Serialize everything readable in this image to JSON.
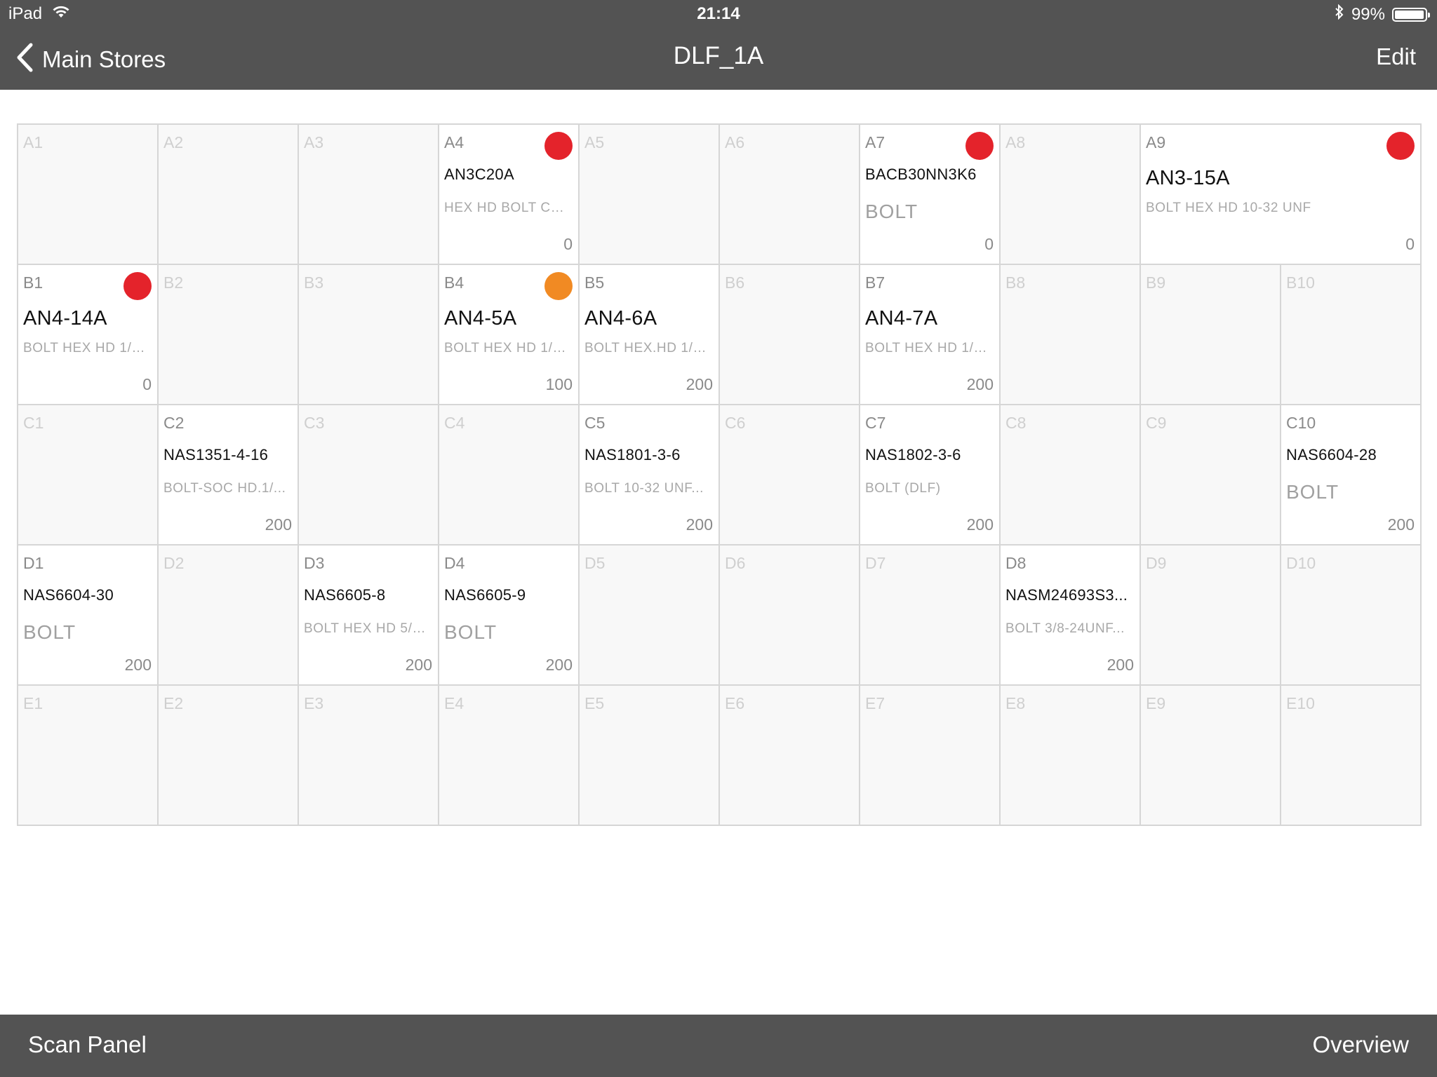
{
  "status_bar": {
    "device": "iPad",
    "time": "21:14",
    "battery": "99%",
    "wifi_icon": "wifi-icon",
    "bluetooth_icon": "bluetooth-icon",
    "battery_icon": "battery-icon",
    "battery_level": 0.99
  },
  "navbar": {
    "back_label": "Main Stores",
    "title": "DLF_1A",
    "edit_label": "Edit"
  },
  "colors": {
    "bar": "#535353",
    "alert_red": "#e4232b",
    "alert_orange": "#f18a23"
  },
  "grid": {
    "rows": [
      {
        "cells": [
          {
            "loc": "A1"
          },
          {
            "loc": "A2"
          },
          {
            "loc": "A3"
          },
          {
            "loc": "A4",
            "part": "AN3C20A",
            "desc": "HEX HD BOLT CR...",
            "qty": "0",
            "dot": "red"
          },
          {
            "loc": "A5"
          },
          {
            "loc": "A6"
          },
          {
            "loc": "A7",
            "part": "BACB30NN3K6",
            "desc": "BOLT",
            "desc_big": true,
            "qty": "0",
            "dot": "red"
          },
          {
            "loc": "A8"
          },
          {
            "loc": "A9",
            "part": "AN3-15A",
            "part_big": true,
            "desc": "BOLT HEX HD 10-32 UNF",
            "qty": "0",
            "dot": "red",
            "wide": true
          }
        ]
      },
      {
        "cells": [
          {
            "loc": "B1",
            "part": "AN4-14A",
            "part_big": true,
            "desc": "BOLT HEX HD 1/4...",
            "qty": "0",
            "dot": "red"
          },
          {
            "loc": "B2"
          },
          {
            "loc": "B3"
          },
          {
            "loc": "B4",
            "part": "AN4-5A",
            "part_big": true,
            "desc": "BOLT HEX HD 1/4...",
            "qty": "100",
            "dot": "orange"
          },
          {
            "loc": "B5",
            "part": "AN4-6A",
            "part_big": true,
            "desc": "BOLT HEX.HD 1/4...",
            "qty": "200"
          },
          {
            "loc": "B6"
          },
          {
            "loc": "B7",
            "part": "AN4-7A",
            "part_big": true,
            "desc": "BOLT HEX HD 1/4...",
            "qty": "200"
          },
          {
            "loc": "B8"
          },
          {
            "loc": "B9"
          },
          {
            "loc": "B10"
          }
        ]
      },
      {
        "cells": [
          {
            "loc": "C1"
          },
          {
            "loc": "C2",
            "part": "NAS1351-4-16",
            "desc": "BOLT-SOC HD.1/...",
            "qty": "200"
          },
          {
            "loc": "C3"
          },
          {
            "loc": "C4"
          },
          {
            "loc": "C5",
            "part": "NAS1801-3-6",
            "desc": "BOLT 10-32 UNF...",
            "qty": "200"
          },
          {
            "loc": "C6"
          },
          {
            "loc": "C7",
            "part": "NAS1802-3-6",
            "desc": "BOLT (DLF)",
            "qty": "200"
          },
          {
            "loc": "C8"
          },
          {
            "loc": "C9"
          },
          {
            "loc": "C10",
            "part": "NAS6604-28",
            "desc": "BOLT",
            "desc_big": true,
            "qty": "200"
          }
        ]
      },
      {
        "cells": [
          {
            "loc": "D1",
            "part": "NAS6604-30",
            "desc": "BOLT",
            "desc_big": true,
            "qty": "200"
          },
          {
            "loc": "D2"
          },
          {
            "loc": "D3",
            "part": "NAS6605-8",
            "desc": "BOLT HEX HD 5/1...",
            "qty": "200"
          },
          {
            "loc": "D4",
            "part": "NAS6605-9",
            "desc": "BOLT",
            "desc_big": true,
            "qty": "200"
          },
          {
            "loc": "D5"
          },
          {
            "loc": "D6"
          },
          {
            "loc": "D7"
          },
          {
            "loc": "D8",
            "part": "NASM24693S3...",
            "desc": "BOLT 3/8-24UNF...",
            "qty": "200"
          },
          {
            "loc": "D9"
          },
          {
            "loc": "D10"
          }
        ]
      },
      {
        "cells": [
          {
            "loc": "E1"
          },
          {
            "loc": "E2"
          },
          {
            "loc": "E3"
          },
          {
            "loc": "E4"
          },
          {
            "loc": "E5"
          },
          {
            "loc": "E6"
          },
          {
            "loc": "E7"
          },
          {
            "loc": "E8"
          },
          {
            "loc": "E9"
          },
          {
            "loc": "E10"
          }
        ]
      }
    ]
  },
  "bottom_bar": {
    "scan_label": "Scan Panel",
    "overview_label": "Overview"
  }
}
